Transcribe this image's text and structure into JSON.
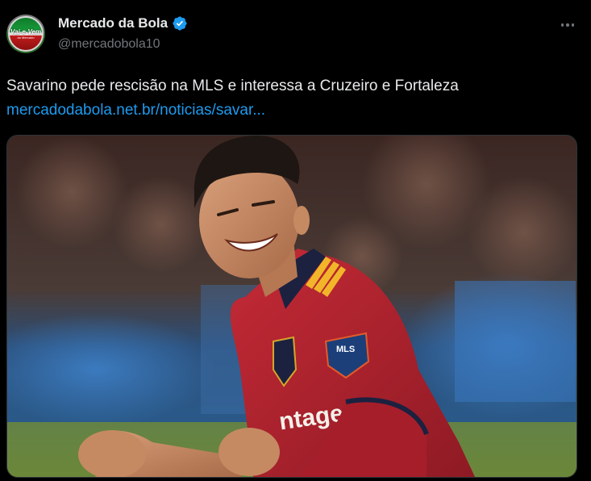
{
  "header": {
    "avatar": {
      "logo_text": "Vai-e-Vem",
      "logo_subtext": "do Mercado"
    },
    "display_name": "Mercado da Bola",
    "verified_icon": "verified-badge-icon",
    "handle": "@mercadobola10",
    "more_icon": "more-options-icon"
  },
  "tweet": {
    "text": "Savarino pede rescisão na MLS e interessa a Cruzeiro e Fortaleza",
    "link": "mercadodabola.net.br/noticias/savar..."
  },
  "media": {
    "description_icon": "photo-icon",
    "sponsor_text": "ntage",
    "badge_text": "MLS"
  },
  "colors": {
    "background": "#000000",
    "link": "#1d9bf0",
    "verified": "#1d9bf0",
    "secondary_text": "#71767b",
    "jersey": "#b8202c"
  }
}
